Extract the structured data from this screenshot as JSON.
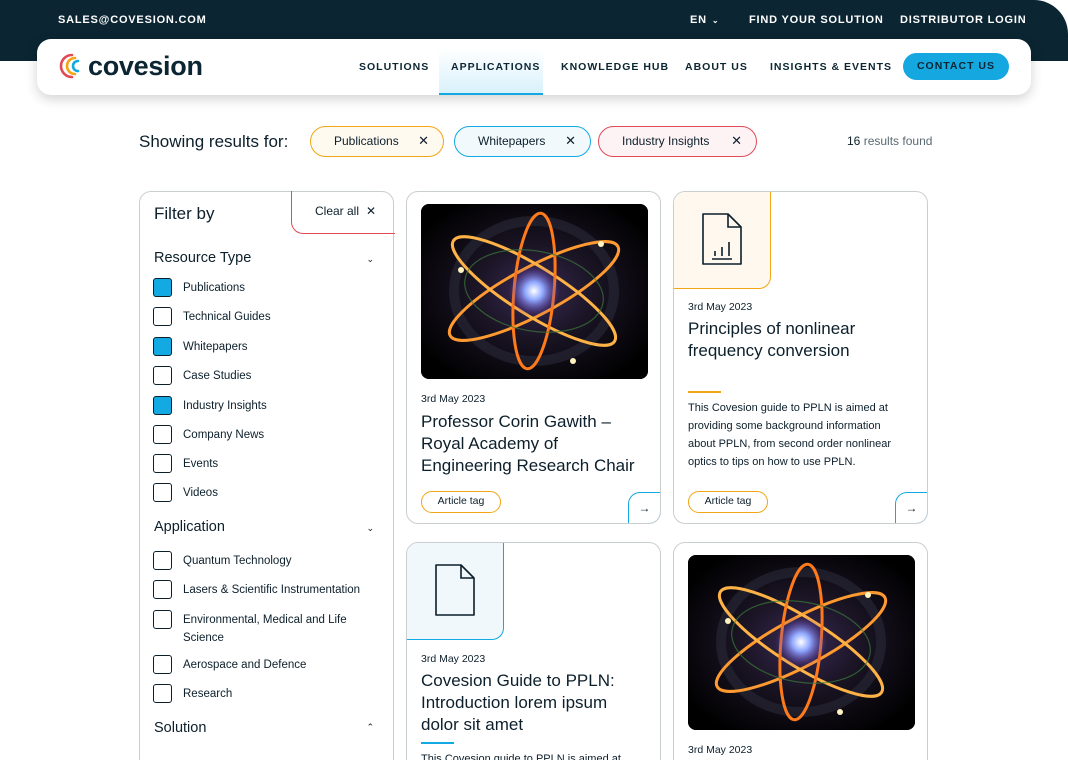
{
  "topbar": {
    "email": "SALES@COVESION.COM",
    "lang": "EN",
    "find": "FIND YOUR SOLUTION",
    "distributor": "DISTRIBUTOR LOGIN"
  },
  "brand": {
    "name": "covesion"
  },
  "nav": {
    "items": [
      "SOLUTIONS",
      "APPLICATIONS",
      "KNOWLEDGE HUB",
      "ABOUT US",
      "INSIGHTS & EVENTS"
    ],
    "active": "APPLICATIONS",
    "contact": "CONTACT US"
  },
  "results": {
    "showing_label": "Showing results for:",
    "chips": [
      {
        "label": "Publications",
        "color": "#f2a515"
      },
      {
        "label": "Whitepapers",
        "color": "#13a9e3"
      },
      {
        "label": "Industry Insights",
        "color": "#e04b57"
      }
    ],
    "count": "16",
    "count_suffix": "results found"
  },
  "filter": {
    "title": "Filter by",
    "clear_all": "Clear all",
    "resource_type": {
      "label": "Resource Type",
      "options": [
        {
          "label": "Publications",
          "checked": true
        },
        {
          "label": "Technical Guides",
          "checked": false
        },
        {
          "label": "Whitepapers",
          "checked": true
        },
        {
          "label": "Case Studies",
          "checked": false
        },
        {
          "label": "Industry Insights",
          "checked": true
        },
        {
          "label": "Company News",
          "checked": false
        },
        {
          "label": "Events",
          "checked": false
        },
        {
          "label": "Videos",
          "checked": false
        }
      ]
    },
    "application": {
      "label": "Application",
      "options": [
        {
          "label": "Quantum Technology",
          "checked": false
        },
        {
          "label": "Lasers & Scientific Instrumentation",
          "checked": false
        },
        {
          "label": "Environmental, Medical and Life Science",
          "checked": false
        },
        {
          "label": "Aerospace and Defence",
          "checked": false
        },
        {
          "label": "Research",
          "checked": false
        }
      ]
    },
    "solution": {
      "label": "Solution"
    }
  },
  "cards": [
    {
      "date": "3rd May 2023",
      "title": "Professor Corin Gawith – Royal Academy of Engineering Research Chair",
      "tag": "Article tag"
    },
    {
      "date": "3rd May 2023",
      "title": "Principles of nonlinear frequency conversion",
      "description": "This Covesion guide to PPLN is aimed at providing some background information about PPLN, from second order nonlinear optics to tips on how to use PPLN.",
      "tag": "Article tag",
      "accent": "#f2a515"
    },
    {
      "date": "3rd May 2023",
      "title": "Covesion Guide to PPLN: Introduction lorem ipsum dolor sit amet",
      "description": "This Covesion guide to PPLN is aimed at",
      "accent": "#13a9e3"
    },
    {
      "date": "3rd May 2023"
    }
  ],
  "colors": {
    "dark": "#0b2532",
    "accent_blue": "#13a9e3",
    "accent_orange": "#f2a515",
    "accent_red": "#e04b57"
  },
  "icons": [
    "chevron-down-icon",
    "close-icon",
    "arrow-right-icon",
    "document-chart-icon",
    "document-icon",
    "covesion-logo-arcs"
  ]
}
